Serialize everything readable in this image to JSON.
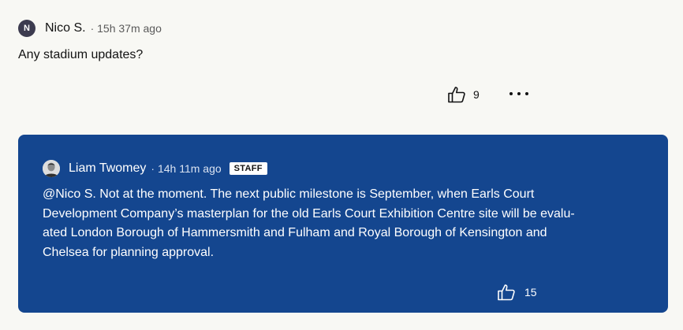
{
  "comment": {
    "avatar_initial": "N",
    "author": "Nico S.",
    "meta": "· 15h 37m ago",
    "body": "Any stadium updates?",
    "like_count": "9",
    "more_icon": "more-horizontal-icon"
  },
  "reply": {
    "author": "Liam Twomey",
    "meta": "· 14h 11m ago",
    "badge": "STAFF",
    "body_lines": [
      "@Nico S. Not at the moment. The next public milestone is September, when Earls Court",
      "Development Company’s masterplan for the old Earls Court Exhibition Centre site will be evalu-",
      "ated London Borough of Hammersmith and Fulham and Royal Borough of Kensington and",
      "Chelsea for planning approval."
    ],
    "like_count": "15",
    "background": "#14468f"
  }
}
